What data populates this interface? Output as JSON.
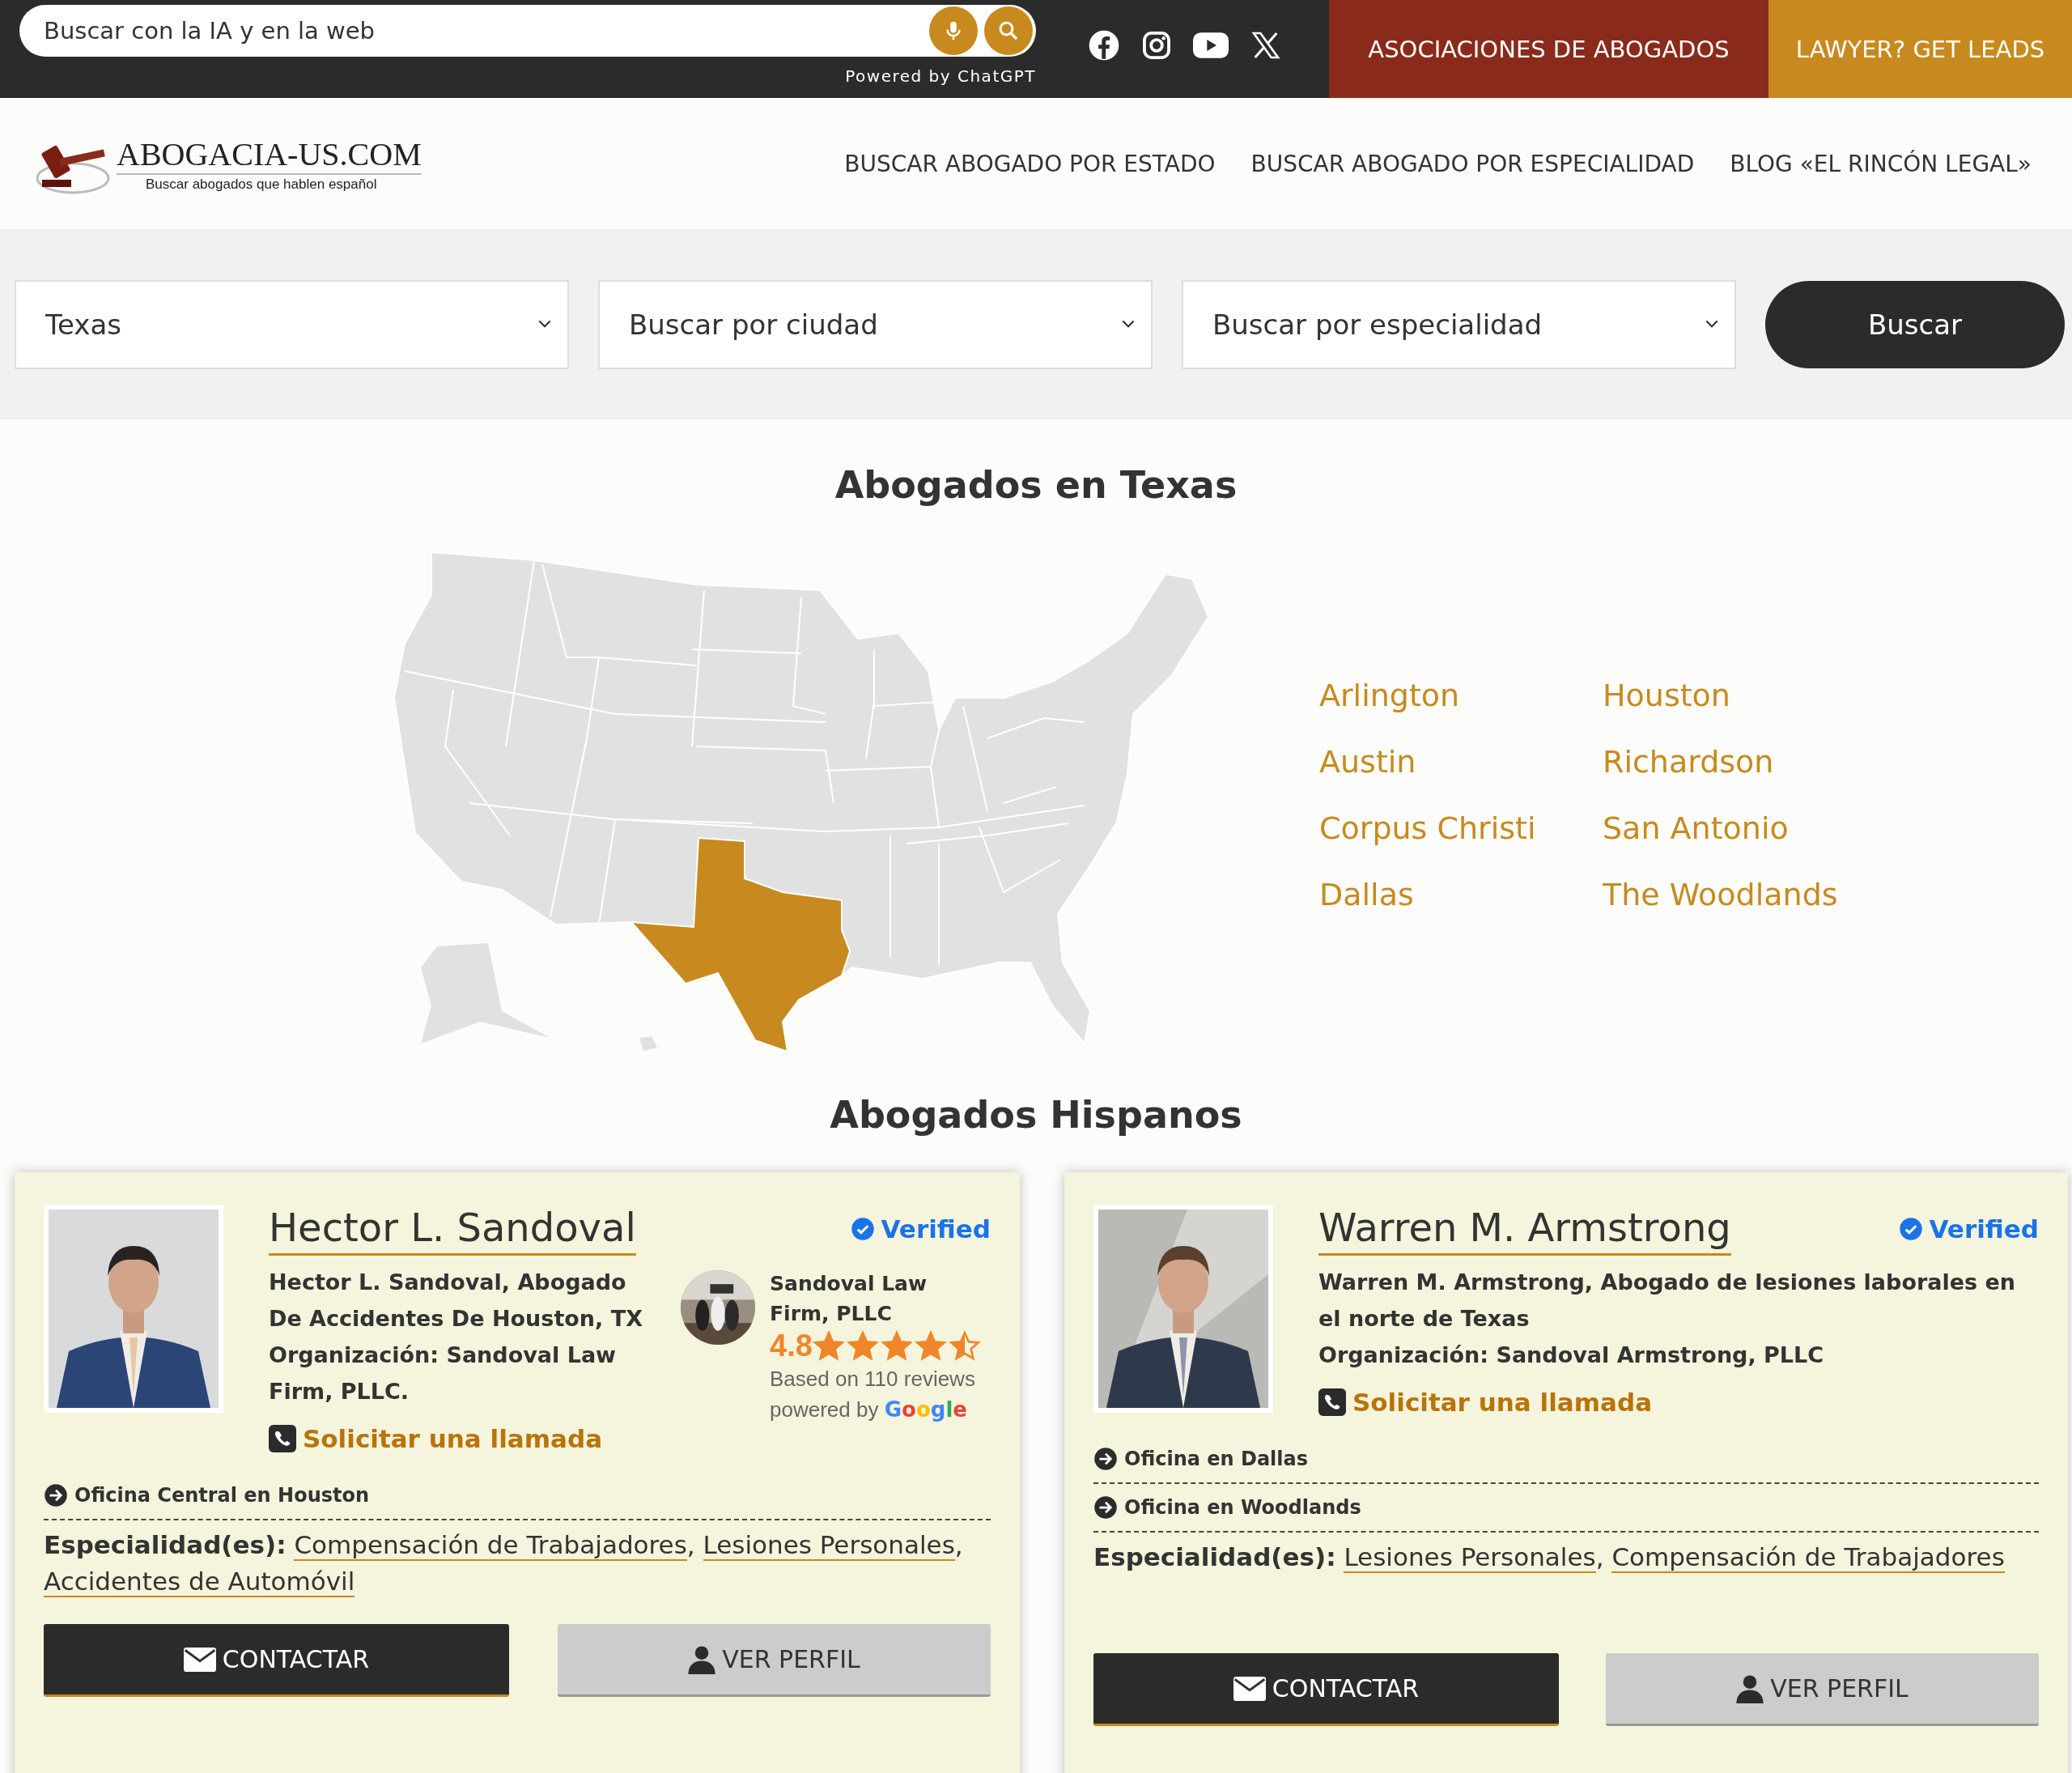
{
  "search": {
    "placeholder": "Buscar con la IA y en la web",
    "powered_by": "Powered by ChatGPT"
  },
  "top_links": [
    {
      "label": "ASOCIACIONES DE ABOGADOS",
      "kind": "association"
    },
    {
      "label": "LAWYER? GET LEADS",
      "kind": "leads"
    }
  ],
  "logo": {
    "name": "ABOGACIA-US.COM",
    "tagline": "Buscar abogados que hablen español"
  },
  "nav": [
    "BUSCAR ABOGADO POR ESTADO",
    "BUSCAR ABOGADO POR ESPECIALIDAD",
    "BLOG «EL RINCÓN LEGAL»"
  ],
  "filters": {
    "selects": [
      {
        "value": "Texas"
      },
      {
        "placeholder": "Buscar por ciudad"
      },
      {
        "placeholder": "Buscar por especialidad"
      }
    ],
    "button": "Buscar"
  },
  "map_section": {
    "title": "Abogados en Texas",
    "cities": [
      "Arlington",
      "Austin",
      "Corpus Christi",
      "Dallas",
      "Houston",
      "Richardson",
      "San Antonio",
      "The Woodlands"
    ]
  },
  "lawyers_title": "Abogados Hispanos",
  "lawyers": [
    {
      "name": "Hector L. Sandoval",
      "verified": "Verified",
      "description": "Hector L. Sandoval, Abogado De Accidentes De Houston, TX",
      "organization": "Organización: Sandoval Law Firm, PLLC.",
      "call": "Solicitar una llamada",
      "review": {
        "firm": "Sandoval Law Firm, PLLC",
        "rating": "4.8",
        "stars": 4.5,
        "count": "Based on 110 reviews",
        "powered_by": "powered by",
        "brand": "Google"
      },
      "offices": [
        "Oficina Central en Houston"
      ],
      "specialties_label": "Especialidad(es):",
      "specialties": [
        {
          "label": "Compensación de Trabajadores",
          "separator": ","
        },
        {
          "label": "Lesiones Personales",
          "separator": ","
        },
        {
          "label": "Accidentes de Automóvil"
        }
      ],
      "contact": "CONTACTAR",
      "profile": "VER PERFIL"
    },
    {
      "name": "Warren M. Armstrong",
      "verified": "Verified",
      "description": "Warren M. Armstrong, Abogado de lesiones laborales en el norte de Texas",
      "organization": "Organización: Sandoval Armstrong, PLLC",
      "call": "Solicitar una llamada",
      "offices": [
        "Oficina en Dallas",
        "Oficina en Woodlands"
      ],
      "specialties_label": "Especialidad(es):",
      "specialties": [
        {
          "label": "Lesiones Personales",
          "separator": ","
        },
        {
          "label": "Compensación de Trabajadores"
        }
      ],
      "contact": "CONTACTAR",
      "profile": "VER PERFIL"
    }
  ]
}
